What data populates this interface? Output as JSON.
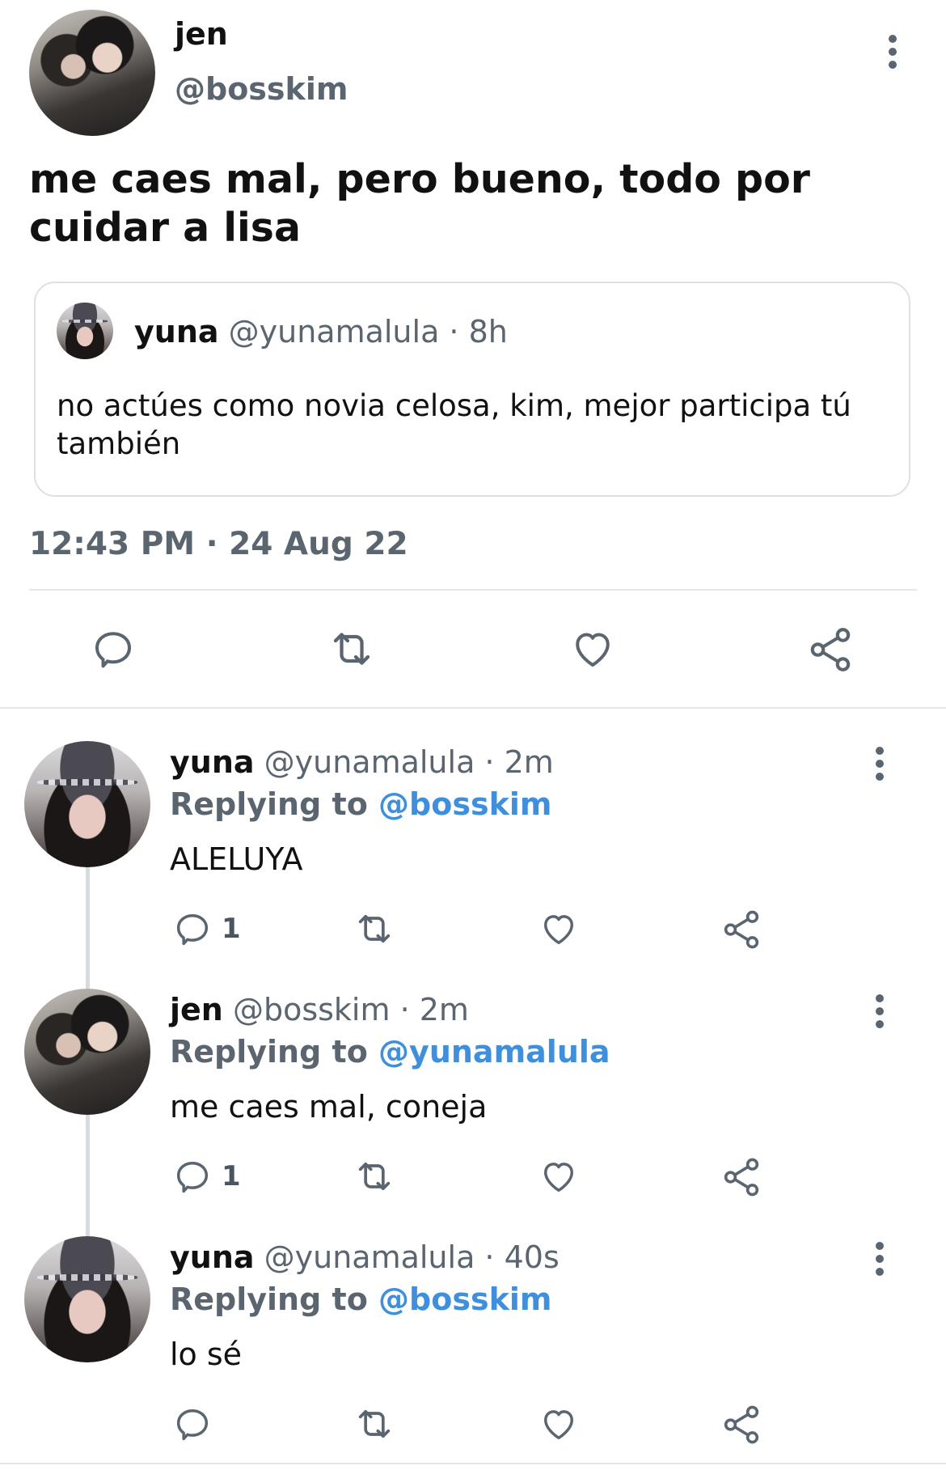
{
  "main_tweet": {
    "display_name": "jen",
    "handle": "@bosskim",
    "text": "me caes mal, pero bueno, todo por cuidar a lisa",
    "timestamp": "12:43 PM · 24 Aug 22"
  },
  "quoted_tweet": {
    "display_name": "yuna",
    "meta": "@yunamalula · 8h",
    "text": "no actúes como novia celosa, kim, mejor participa tú también"
  },
  "replies": [
    {
      "display_name": "yuna",
      "meta": "@yunamalula · 2m",
      "replying_label": "Replying to",
      "replying_to": "@bosskim",
      "text": "ALELUYA",
      "reply_count": "1"
    },
    {
      "display_name": "jen",
      "meta": "@bosskim · 2m",
      "replying_label": "Replying to",
      "replying_to": "@yunamalula",
      "text": "me caes mal, coneja",
      "reply_count": "1"
    },
    {
      "display_name": "yuna",
      "meta": "@yunamalula · 40s",
      "replying_label": "Replying to",
      "replying_to": "@bosskim",
      "text": "lo sé",
      "reply_count": ""
    }
  ],
  "icons": [
    "reply-icon",
    "retweet-icon",
    "like-icon",
    "share-icon",
    "more-options-icon"
  ],
  "colors": {
    "text": "#111111",
    "secondary": "#5b6570",
    "link": "#3f8fdd",
    "divider": "#e4e7ea"
  }
}
